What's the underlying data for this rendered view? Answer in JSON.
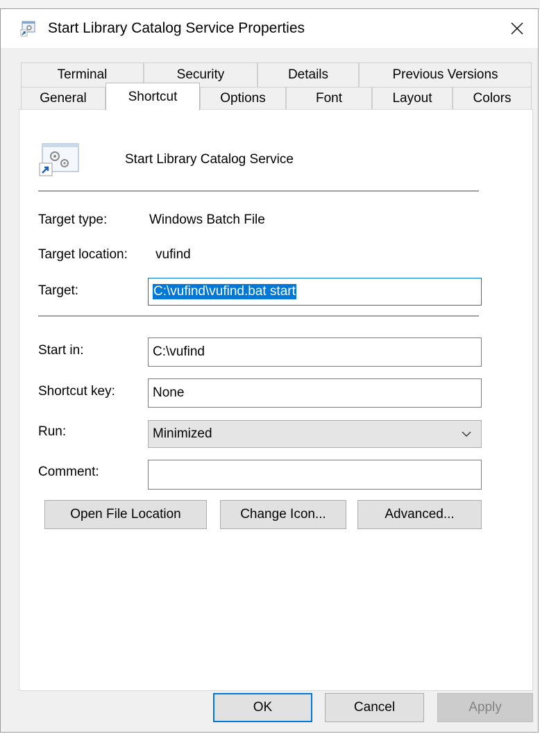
{
  "window": {
    "title": "Start Library Catalog Service Properties"
  },
  "tabs": {
    "row1": [
      "Terminal",
      "Security",
      "Details",
      "Previous Versions"
    ],
    "row2": [
      "General",
      "Shortcut",
      "Options",
      "Font",
      "Layout",
      "Colors"
    ],
    "active": "Shortcut"
  },
  "shortcut": {
    "name": "Start Library Catalog Service",
    "target_type_label": "Target type:",
    "target_type_value": "Windows Batch File",
    "target_location_label": "Target location:",
    "target_location_value": "vufind",
    "target_label": "Target:",
    "target_value": "C:\\vufind\\vufind.bat start",
    "start_in_label": "Start in:",
    "start_in_value": "C:\\vufind",
    "shortcut_key_label": "Shortcut key:",
    "shortcut_key_value": "None",
    "run_label": "Run:",
    "run_value": "Minimized",
    "comment_label": "Comment:",
    "comment_value": "",
    "open_file_location": "Open File Location",
    "change_icon": "Change Icon...",
    "advanced": "Advanced..."
  },
  "footer": {
    "ok": "OK",
    "cancel": "Cancel",
    "apply": "Apply"
  },
  "colors": {
    "accent": "#0078d7",
    "window_bg": "#f0f0f0"
  }
}
